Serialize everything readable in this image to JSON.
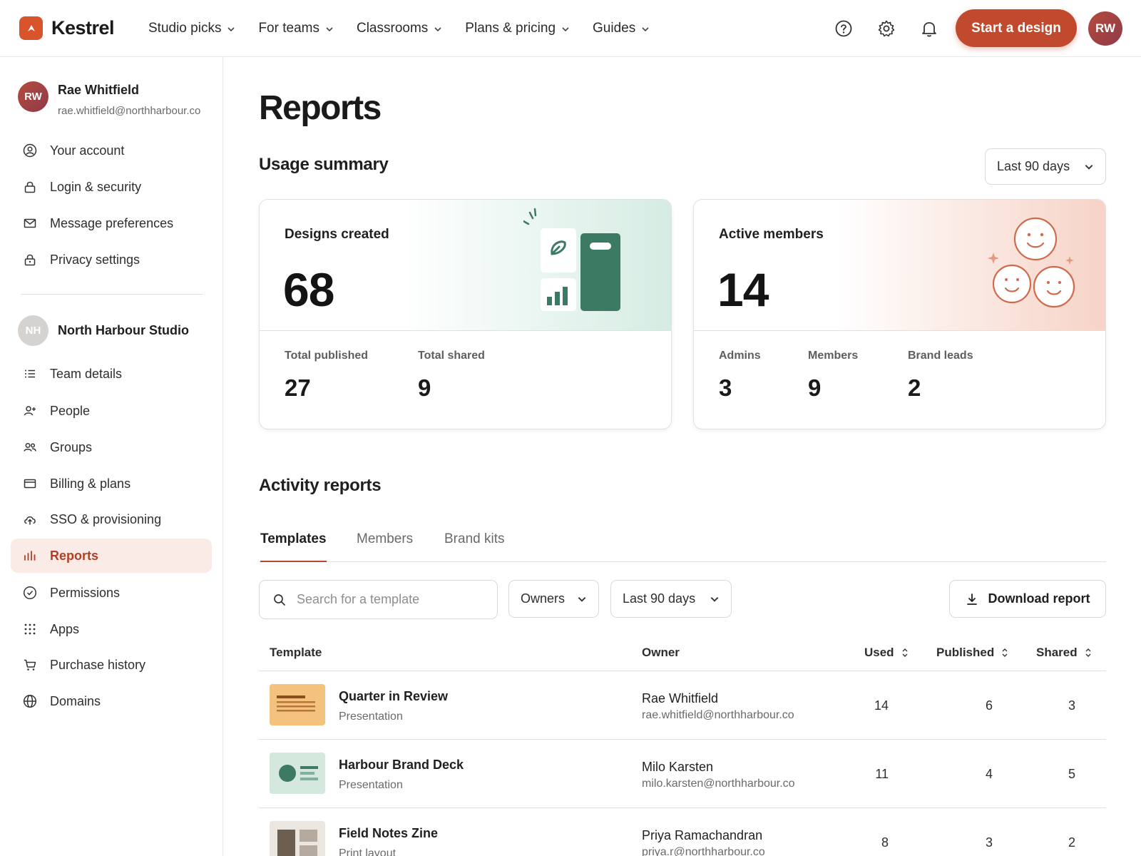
{
  "brand": {
    "name": "Kestrel"
  },
  "nav": [
    {
      "label": "Studio picks"
    },
    {
      "label": "For teams"
    },
    {
      "label": "Classrooms"
    },
    {
      "label": "Plans & pricing"
    },
    {
      "label": "Guides"
    }
  ],
  "header": {
    "start_label": "Start a design",
    "avatar_initials": "RW",
    "icons": [
      "help-icon",
      "gear-icon",
      "bell-icon"
    ]
  },
  "sidebar": {
    "profile": {
      "initials": "RW",
      "name": "Rae Whitfield",
      "email": "rae.whitfield@northharbour.co"
    },
    "account_items": [
      {
        "label": "Your account",
        "icon": "user-circle-icon"
      },
      {
        "label": "Login & security",
        "icon": "lock-icon"
      },
      {
        "label": "Message preferences",
        "icon": "mail-icon"
      },
      {
        "label": "Privacy settings",
        "icon": "lock-icon"
      }
    ],
    "team": {
      "initials": "NH",
      "name": "North Harbour Studio"
    },
    "team_items": [
      {
        "label": "Team details",
        "icon": "list-icon"
      },
      {
        "label": "People",
        "icon": "user-plus-icon"
      },
      {
        "label": "Groups",
        "icon": "users-icon"
      },
      {
        "label": "Billing & plans",
        "icon": "credit-card-icon"
      },
      {
        "label": "SSO & provisioning",
        "icon": "cloud-upload-icon"
      },
      {
        "label": "Reports",
        "icon": "bar-chart-icon",
        "active": true
      },
      {
        "label": "Permissions",
        "icon": "check-circle-icon"
      },
      {
        "label": "Apps",
        "icon": "grid-dots-icon"
      },
      {
        "label": "Purchase history",
        "icon": "cart-icon"
      },
      {
        "label": "Domains",
        "icon": "globe-icon"
      }
    ]
  },
  "main": {
    "title": "Reports",
    "usage": {
      "title": "Usage summary",
      "range": "Last 90 days",
      "designs": {
        "label": "Designs created",
        "value": "68",
        "stats": [
          {
            "label": "Total published",
            "value": "27"
          },
          {
            "label": "Total shared",
            "value": "9"
          }
        ]
      },
      "members": {
        "label": "Active members",
        "value": "14",
        "stats": [
          {
            "label": "Admins",
            "value": "3"
          },
          {
            "label": "Members",
            "value": "9"
          },
          {
            "label": "Brand leads",
            "value": "2"
          }
        ]
      }
    },
    "activity": {
      "title": "Activity reports",
      "tabs": [
        {
          "label": "Templates",
          "active": true
        },
        {
          "label": "Members"
        },
        {
          "label": "Brand kits"
        }
      ],
      "search_placeholder": "Search for a template",
      "owners_filter": "Owners",
      "range_filter": "Last 90 days",
      "download_label": "Download report",
      "columns": {
        "template": "Template",
        "owner": "Owner",
        "used": "Used",
        "published": "Published",
        "shared": "Shared"
      },
      "rows": [
        {
          "name": "Quarter in Review",
          "type": "Presentation",
          "owner": "Rae Whitfield",
          "email": "rae.whitfield@northharbour.co",
          "used": "14",
          "published": "6",
          "shared": "3"
        },
        {
          "name": "Harbour Brand Deck",
          "type": "Presentation",
          "owner": "Milo Karsten",
          "email": "milo.karsten@northharbour.co",
          "used": "11",
          "published": "4",
          "shared": "5"
        },
        {
          "name": "Field Notes Zine",
          "type": "Print layout",
          "owner": "Priya Ramachandran",
          "email": "priya.r@northharbour.co",
          "used": "8",
          "published": "3",
          "shared": "2"
        }
      ]
    }
  },
  "colors": {
    "accent": "#c14a2e",
    "active_bg": "#fbebe6",
    "green": "#3d7a64",
    "orange": "#d06a4a"
  }
}
